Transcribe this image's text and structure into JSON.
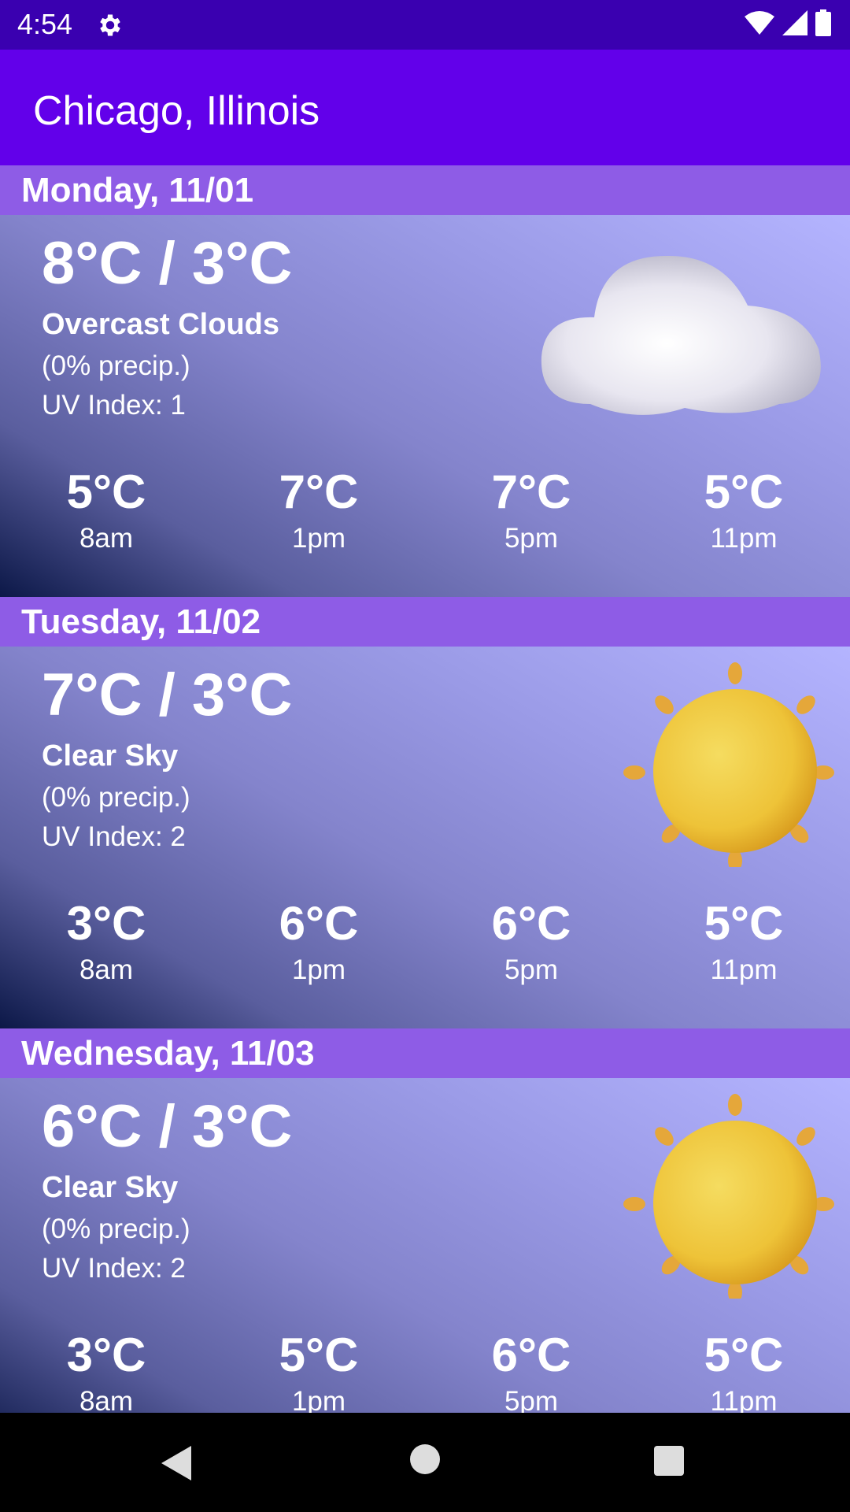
{
  "status_bar": {
    "time": "4:54",
    "icons": [
      "settings-gear-icon",
      "wifi-icon",
      "cell-signal-icon",
      "battery-icon"
    ]
  },
  "app_bar": {
    "title": "Chicago, Illinois"
  },
  "days": [
    {
      "header": "Monday, 11/01",
      "temp_range": "8°C / 3°C",
      "condition": "Overcast Clouds",
      "precip": "(0% precip.)",
      "uv": "UV Index: 1",
      "icon": "cloud-icon",
      "hourly": [
        {
          "temp": "5°C",
          "time": "8am"
        },
        {
          "temp": "7°C",
          "time": "1pm"
        },
        {
          "temp": "7°C",
          "time": "5pm"
        },
        {
          "temp": "5°C",
          "time": "11pm"
        }
      ]
    },
    {
      "header": "Tuesday, 11/02",
      "temp_range": "7°C / 3°C",
      "condition": "Clear Sky",
      "precip": "(0% precip.)",
      "uv": "UV Index: 2",
      "icon": "sun-icon",
      "hourly": [
        {
          "temp": "3°C",
          "time": "8am"
        },
        {
          "temp": "6°C",
          "time": "1pm"
        },
        {
          "temp": "6°C",
          "time": "5pm"
        },
        {
          "temp": "5°C",
          "time": "11pm"
        }
      ]
    },
    {
      "header": "Wednesday, 11/03",
      "temp_range": "6°C / 3°C",
      "condition": "Clear Sky",
      "precip": "(0% precip.)",
      "uv": "UV Index: 2",
      "icon": "sun-icon",
      "hourly": [
        {
          "temp": "3°C",
          "time": "8am"
        },
        {
          "temp": "5°C",
          "time": "1pm"
        },
        {
          "temp": "6°C",
          "time": "5pm"
        },
        {
          "temp": "5°C",
          "time": "11pm"
        }
      ]
    }
  ],
  "nav_bar": {
    "icons": [
      "back-icon",
      "home-icon",
      "recents-icon"
    ]
  },
  "colors": {
    "status_bar": "#3a00b0",
    "app_bar": "#6200ea",
    "day_header": "#8e5ce6"
  }
}
